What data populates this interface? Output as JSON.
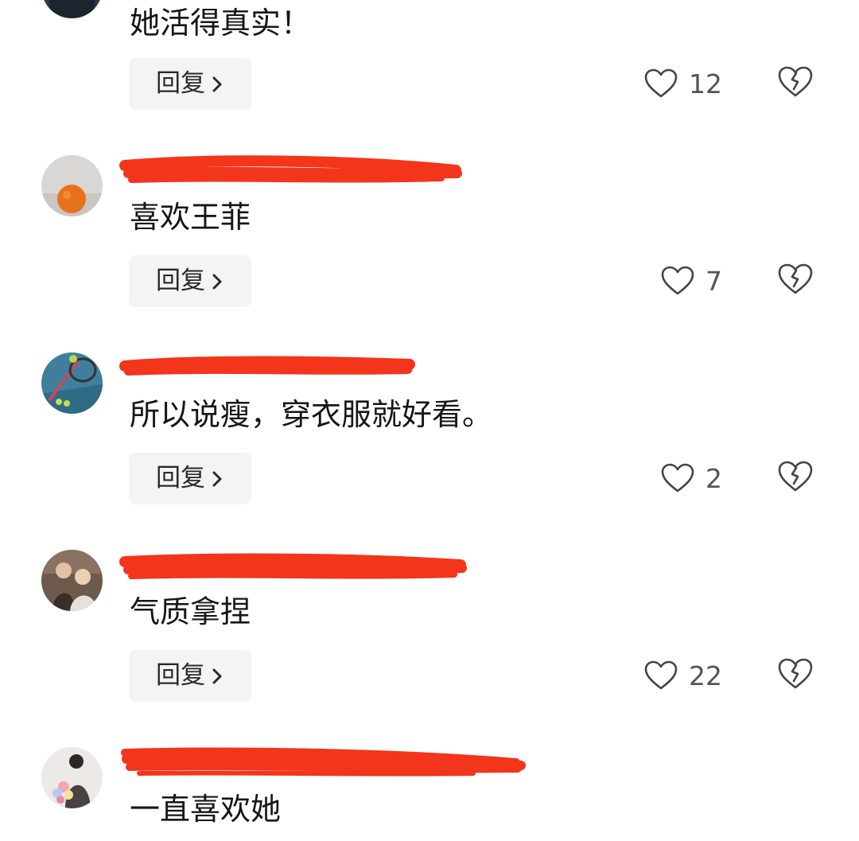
{
  "comments": [
    {
      "text": "她活得真实！",
      "reply_label": "回复",
      "likes": "12",
      "username_redacted": false
    },
    {
      "text": "喜欢王菲",
      "reply_label": "回复",
      "likes": "7",
      "username_redacted": true
    },
    {
      "text": "所以说瘦，穿衣服就好看。",
      "reply_label": "回复",
      "likes": "2",
      "username_redacted": true
    },
    {
      "text": "气质拿捏",
      "reply_label": "回复",
      "likes": "22",
      "username_redacted": true
    },
    {
      "text": "一直喜欢她",
      "reply_label": null,
      "likes": null,
      "username_redacted": true
    }
  ],
  "icons": {
    "like": "heart-outline-icon",
    "dislike": "broken-heart-icon",
    "reply_arrow": "chevron-right-icon"
  },
  "colors": {
    "redaction": "#f2351b",
    "reply_bg": "#f4f4f4",
    "text": "#161616",
    "secondary": "#555555"
  }
}
